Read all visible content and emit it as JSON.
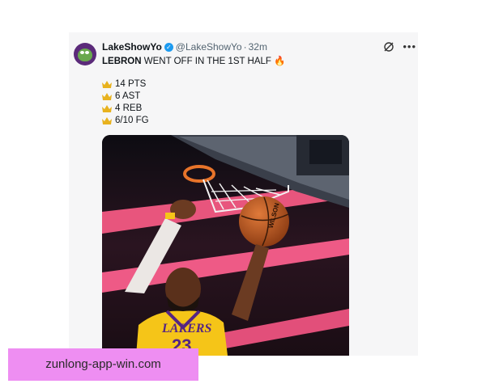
{
  "tweet": {
    "display_name": "LakeShowYo",
    "handle": "@LakeShowYo",
    "separator": "·",
    "time": "32m",
    "text_name": "LEBRON",
    "text_rest": " WENT OFF IN THE 1ST HALF",
    "text_emoji": "🔥",
    "stats": [
      "14 PTS",
      "6 AST",
      "4 REB",
      "6/10 FG"
    ],
    "image": {
      "jersey_text": "LAKERS",
      "jersey_number": "23",
      "brand_text": "WILSON"
    }
  },
  "icons": {
    "avatar": "frog-avatar",
    "verified": "verified-badge-icon",
    "grok": "grok-icon",
    "more": "more-icon",
    "crown": "crown-icon"
  },
  "colors": {
    "verified": "#1d9bf0",
    "watermark_bg": "#ee8ef2",
    "card_bg": "#f6f6f7",
    "jersey": "#f5c518",
    "jersey_text": "#552583"
  },
  "watermark": {
    "text": "zunlong-app-win.com"
  }
}
